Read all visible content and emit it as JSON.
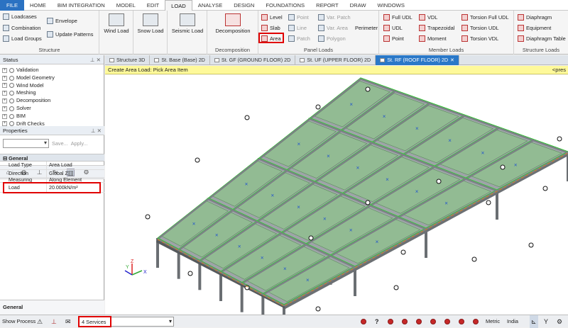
{
  "menu": {
    "file": "FILE",
    "tabs": [
      "HOME",
      "BIM INTEGRATION",
      "MODEL",
      "EDIT",
      "LOAD",
      "ANALYSE",
      "DESIGN",
      "FOUNDATIONS",
      "REPORT",
      "DRAW",
      "WINDOWS"
    ],
    "active": "LOAD"
  },
  "ribbon": {
    "structure": {
      "loadcases": "Loadcases",
      "envelope": "Envelope",
      "combination": "Combination",
      "load_groups": "Load Groups",
      "update_patterns": "Update Patterns",
      "label": "Structure"
    },
    "wind_load": "Wind Load",
    "snow_load": "Snow Load",
    "seismic_load": "Seismic Load",
    "decomposition": {
      "button": "Decomposition",
      "label": "Decomposition"
    },
    "panel_loads": {
      "level": "Level",
      "slab": "Slab",
      "area": "Area",
      "point": "Point",
      "line": "Line",
      "patch": "Patch",
      "var_patch": "Var. Patch",
      "var_area": "Var. Area",
      "polygon": "Polygon",
      "perimeter": "Perimeter",
      "label": "Panel Loads"
    },
    "member_loads": {
      "full_udl": "Full UDL",
      "udl": "UDL",
      "point": "Point",
      "vdl": "VDL",
      "trapezoidal": "Trapezoidal",
      "moment": "Moment",
      "torsion_full_udl": "Torsion Full UDL",
      "torsion_udl": "Torsion UDL",
      "torsion_vdl": "Torsion VDL",
      "label": "Member Loads"
    },
    "structure_loads": {
      "diaphragm": "Diaphragm",
      "equipment": "Equipment",
      "diaphragm_table": "Diaphragm Table",
      "label": "Structure Loads"
    }
  },
  "status_panel": {
    "title": "Status",
    "items": [
      "Validation",
      "Model Geometry",
      "Wind Model",
      "Meshing",
      "Decomposition",
      "Solver",
      "BIM",
      "Drift Checks"
    ]
  },
  "properties": {
    "title": "Properties",
    "save": "Save...",
    "apply": "Apply...",
    "section": "General",
    "rows": [
      {
        "key": "Load Type",
        "value": "Area Load"
      },
      {
        "key": "Direction",
        "value": "Global Z"
      },
      {
        "key": "Measuring",
        "value": "Along Element"
      },
      {
        "key": "Load",
        "value": "20.000kN/m²"
      }
    ],
    "footer": "General"
  },
  "doc_tabs": [
    "Structure 3D",
    "St. Base (Base) 2D",
    "St. GF (GROUND FLOOR) 2D",
    "St. UF (UPPER FLOOR) 2D",
    "St. RF (ROOF FLOOR) 2D"
  ],
  "active_tab": "St. RF (ROOF FLOOR) 2D",
  "command": {
    "prompt": "Create Area Load: Pick Area Item",
    "right": "<pres"
  },
  "axes": {
    "x": "X",
    "y": "Y",
    "z": "Z"
  },
  "statusbar": {
    "show_process": "Show Process",
    "services": "4 Services",
    "units": "Metric",
    "region": "India"
  },
  "colors": {
    "accent": "#2a78c8",
    "highlight": "#e00000",
    "slab_fill": "#8fbf8f",
    "grid_line": "#22dd22",
    "command_bar": "#fef99a"
  }
}
